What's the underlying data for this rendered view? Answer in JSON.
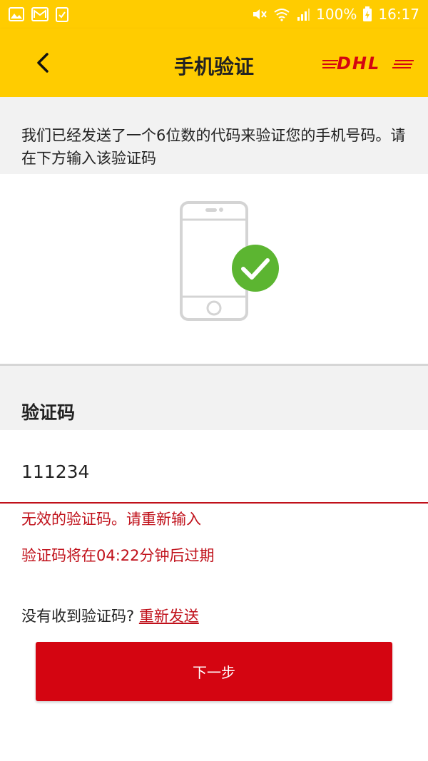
{
  "status_bar": {
    "battery": "100%",
    "time": "16:17",
    "icons_left": [
      "image-icon",
      "mail-icon",
      "task-icon"
    ],
    "icons_right": [
      "mute-icon",
      "wifi-icon",
      "signal-icon",
      "battery-charging-icon"
    ]
  },
  "header": {
    "title": "手机验证",
    "logo_text": "DHL",
    "brand_color": "#ffcc00",
    "logo_color": "#d40511"
  },
  "intro": {
    "text": "我们已经发送了一个6位数的代码来验证您的手机号码。请在下方输入该验证码"
  },
  "code_section": {
    "label": "验证码",
    "input_value": "111234"
  },
  "messages": {
    "error": "无效的验证码。请重新输入",
    "expire": "验证码将在04:22分钟后过期"
  },
  "resend": {
    "prompt": "没有收到验证码?",
    "link": "重新发送"
  },
  "actions": {
    "next": "下一步",
    "button_color": "#d40511"
  },
  "colors": {
    "error": "#c0101a",
    "success_check": "#5cb531"
  }
}
